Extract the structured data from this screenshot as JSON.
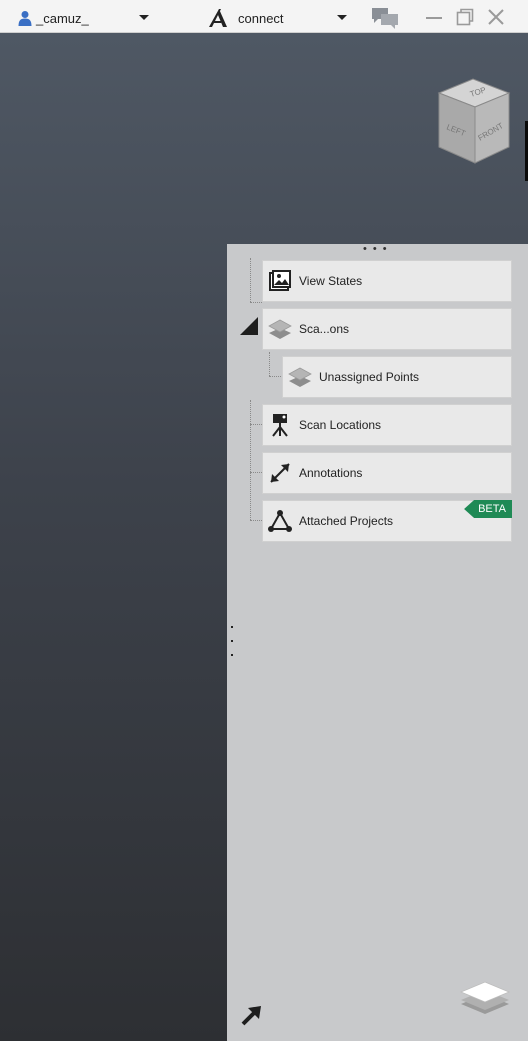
{
  "titlebar": {
    "username": "_camuz_",
    "connect_label": "connect"
  },
  "viewcube": {
    "top": "TOP",
    "left": "LEFT",
    "front": "FRONT"
  },
  "panel": {
    "items": [
      {
        "label": "View States",
        "icon": "image-icon"
      },
      {
        "label": "Sca...ons",
        "icon": "layers-icon"
      },
      {
        "label": "Unassigned Points",
        "icon": "layers-icon"
      },
      {
        "label": "Scan Locations",
        "icon": "scanner-tripod-icon"
      },
      {
        "label": "Annotations",
        "icon": "arrow-diagonal-icon"
      },
      {
        "label": "Attached Projects",
        "icon": "network-triangle-icon",
        "badge": "BETA"
      }
    ],
    "badge_color": "#1f8a55"
  }
}
